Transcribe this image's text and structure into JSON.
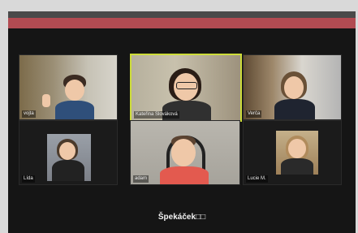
{
  "colors": {
    "accent": "#b24b52",
    "active_speaker_border": "#cddc39"
  },
  "participants": [
    {
      "name": "vojta"
    },
    {
      "name": "Kateřina Slováková"
    },
    {
      "name": "Verča"
    },
    {
      "name": "Lída"
    },
    {
      "name": "adam"
    },
    {
      "name": "Lucie M."
    }
  ],
  "meeting": {
    "title": "Špekáček□□"
  }
}
